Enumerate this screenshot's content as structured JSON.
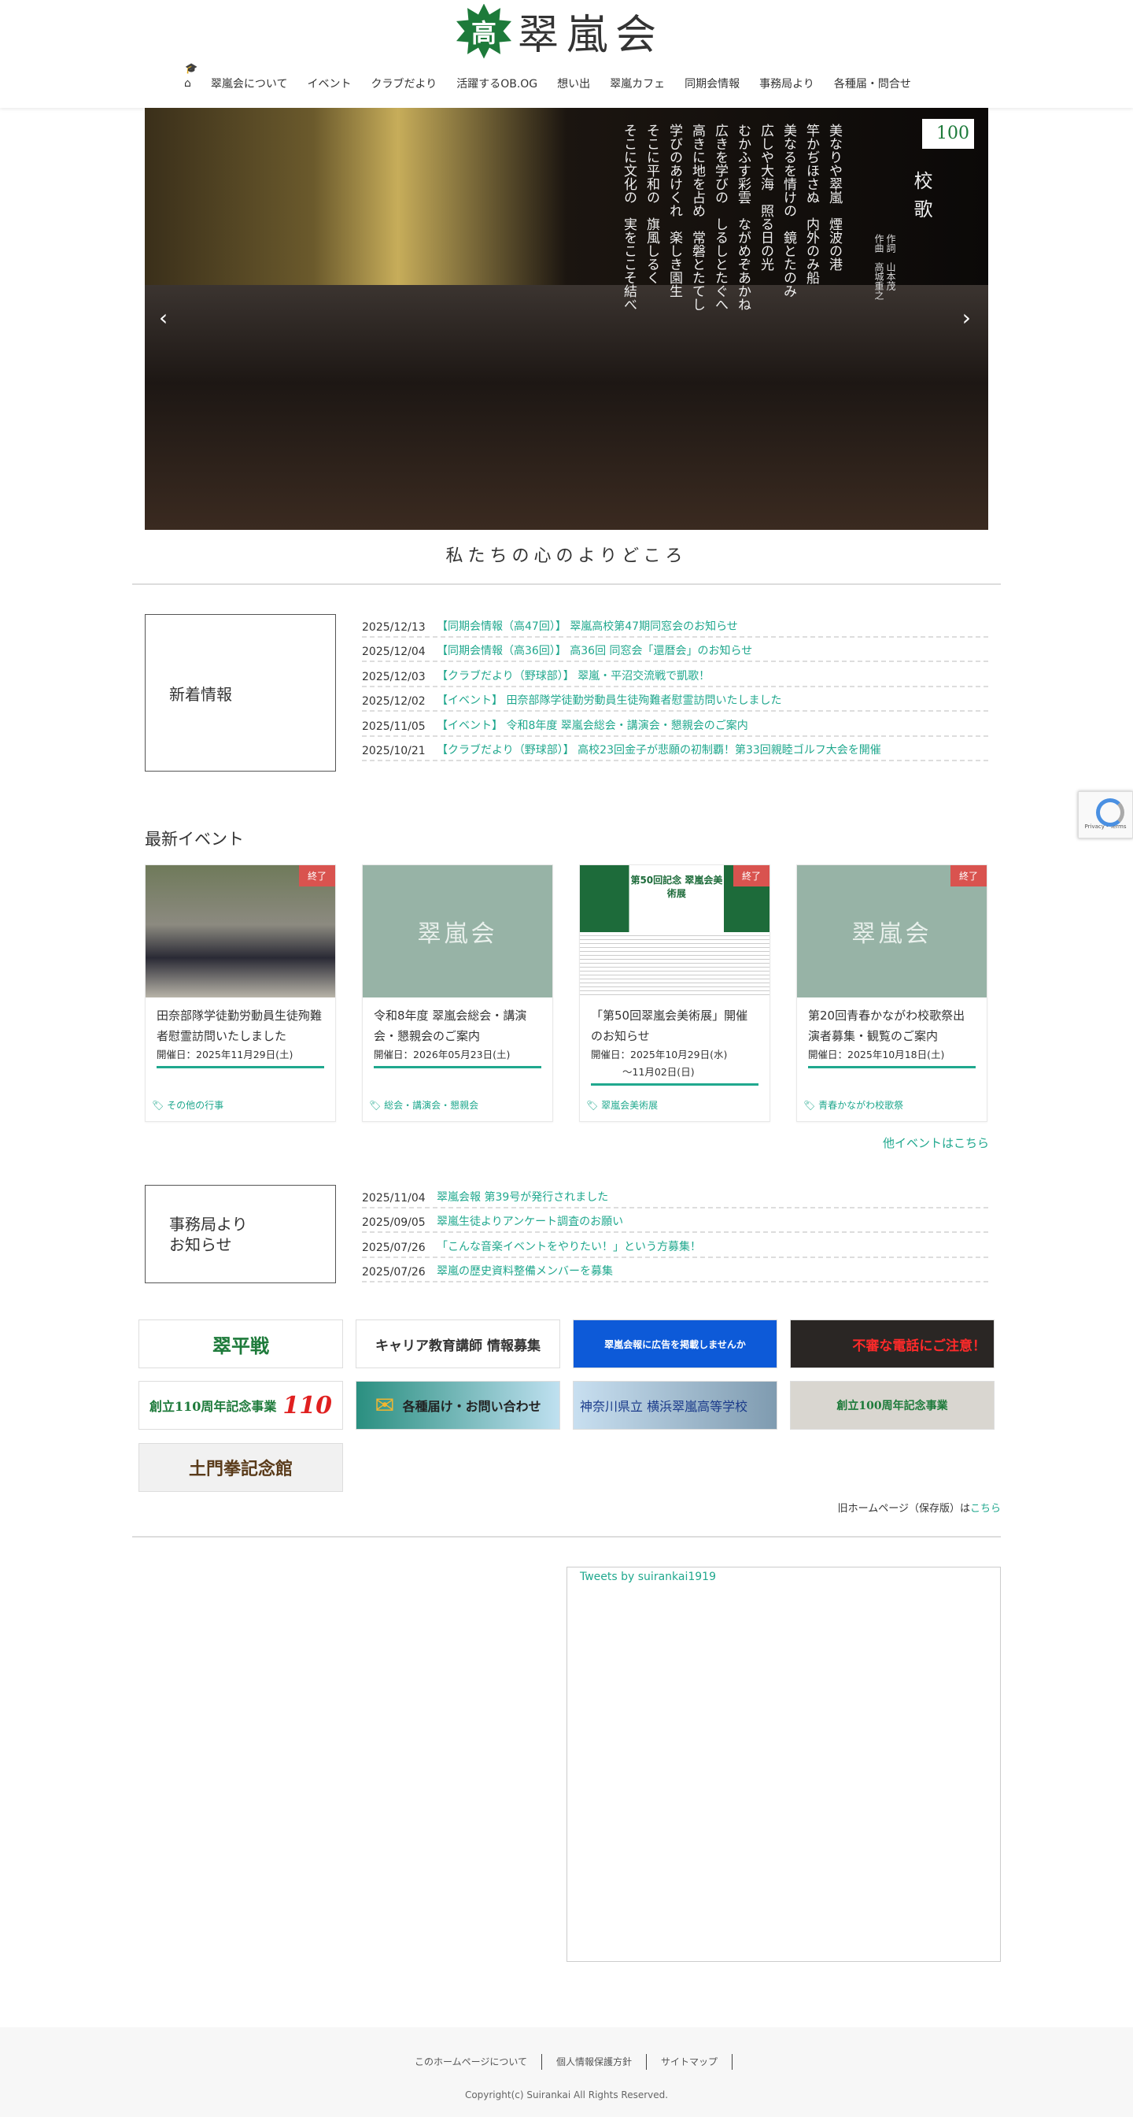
{
  "header": {
    "logo_mark": "高",
    "logo_text": "翠嵐会",
    "nav": [
      "翠嵐会について",
      "イベント",
      "クラブだより",
      "活躍するOB.OG",
      "想い出",
      "翠嵐カフェ",
      "同期会情報",
      "事務局より",
      "各種届・問合せ"
    ]
  },
  "hero": {
    "title": "校歌",
    "credit": [
      "作詞　山本茂",
      "作曲　高城重之"
    ],
    "badge": "100",
    "lyrics": [
      "美なりや翠嵐　煙波の港",
      "竿かぢほさぬ　内外のみ船",
      "美なるを情けの　鏡とたのみ",
      "広しや大海　照る日の光",
      "むかふす彩雲　ながめぞあかね",
      "広きを学びの　しるしとたぐへ",
      "高きに地を占め　常磐とたてし",
      "学びのあけくれ　楽しき園生",
      "そこに平和の　旗風しるく",
      "そこに文化の　実をここそ結べ"
    ]
  },
  "tagline": "私たちの心のよりどころ",
  "news": {
    "title": "新着情報",
    "items": [
      {
        "date": "2025/12/13",
        "text": "【同期会情報（高47回）】 翠嵐高校第47期同窓会のお知らせ"
      },
      {
        "date": "2025/12/04",
        "text": "【同期会情報（高36回）】 高36回 同窓会「還暦会」のお知らせ"
      },
      {
        "date": "2025/12/03",
        "text": "【クラブだより（野球部）】 翠嵐・平沼交流戦で凱歌！"
      },
      {
        "date": "2025/12/02",
        "text": "【イベント】 田奈部隊学徒勤労動員生徒殉難者慰霊訪問いたしました"
      },
      {
        "date": "2025/11/05",
        "text": "【イベント】 令和8年度 翠嵐会総会・講演会・懇親会のご案内"
      },
      {
        "date": "2025/10/21",
        "text": "【クラブだより（野球部）】 高校23回金子が悲願の初制覇！第33回親睦ゴルフ大会を開催"
      }
    ]
  },
  "events": {
    "title": "最新イベント",
    "more": "他イベントはこちら",
    "placeholder_text": "翠嵐会",
    "ended": "終了",
    "date_label": "開催日：",
    "cards": [
      {
        "title": "田奈部隊学徒勤労動員生徒殉難者慰霊訪問いたしました",
        "date": "2025年11月29日(土)",
        "date2": "",
        "tag": "その他の行事",
        "ended": true
      },
      {
        "title": "令和8年度 翠嵐会総会・講演会・懇親会のご案内",
        "date": "2026年05月23日(土)",
        "date2": "",
        "tag": "総会・講演会・懇親会",
        "ended": false
      },
      {
        "title": "「第50回翠嵐会美術展」開催のお知らせ",
        "date": "2025年10月29日(水)",
        "date2": "～11月02日(日)",
        "tag": "翠嵐会美術展",
        "ended": true,
        "poster": "第50回記念 翠嵐会美術展"
      },
      {
        "title": "第20回青春かながわ校歌祭出演者募集・観覧のご案内",
        "date": "2025年10月18日(土)",
        "date2": "",
        "tag": "青春かながわ校歌祭",
        "ended": true
      }
    ]
  },
  "office": {
    "title": "事務局より\nお知らせ",
    "title1": "事務局より",
    "title2": "お知らせ",
    "items": [
      {
        "date": "2025/11/04",
        "text": "翠嵐会報 第39号が発行されました"
      },
      {
        "date": "2025/09/05",
        "text": "翠嵐生徒よりアンケート調査のお願い"
      },
      {
        "date": "2025/07/26",
        "text": "「こんな音楽イベントをやりたい！」という方募集！"
      },
      {
        "date": "2025/07/26",
        "text": "翠嵐の歴史資料整備メンバーを募集"
      }
    ]
  },
  "banners": [
    "翠平戦",
    "キャリア教育講師 情報募集",
    "翠嵐会報に広告を掲載しませんか",
    "不審な電話にご注意！",
    "創立110周年記念事業",
    "各種届け・お問い合わせ",
    "神奈川県立 横浜翠嵐高等学校",
    "創立100周年記念事業",
    "土門拳記念館"
  ],
  "old_site": {
    "text": "旧ホームページ（保存版）は",
    "link": "こちら"
  },
  "twitter": {
    "label": "Tweets by suirankai1919"
  },
  "footer": {
    "links": [
      "このホームページについて",
      "個人情報保護方針",
      "サイトマップ"
    ],
    "copyright": "Copyright(c) Suirankai All Rights Reserved."
  },
  "recaptcha": "Privacy - Terms",
  "colors": {
    "accent": "#20a88e",
    "ended": "#d9534f",
    "placeholder": "#97b3a6"
  }
}
